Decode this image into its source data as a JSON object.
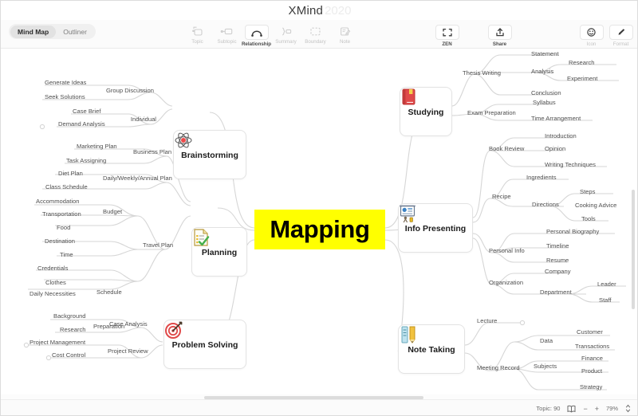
{
  "window": {
    "app_title": "XMind",
    "app_version": "2020"
  },
  "toolbar": {
    "view_tabs": [
      {
        "label": "Mind Map",
        "active": true
      },
      {
        "label": "Outliner",
        "active": false
      }
    ],
    "insert_tools": [
      {
        "label": "Topic",
        "icon": "topic-icon",
        "state": "disabled"
      },
      {
        "label": "Subtopic",
        "icon": "subtopic-icon",
        "state": "disabled"
      },
      {
        "label": "Relationship",
        "icon": "relationship-icon",
        "state": "enabled"
      },
      {
        "label": "Summary",
        "icon": "summary-icon",
        "state": "disabled"
      },
      {
        "label": "Boundary",
        "icon": "boundary-icon",
        "state": "disabled"
      },
      {
        "label": "Note",
        "icon": "note-icon",
        "state": "disabled"
      }
    ],
    "zen_label": "ZEN",
    "zen_icon": "expand-icon",
    "share_label": "Share",
    "share_icon": "share-upload-icon",
    "icon_label": "Icon",
    "icon_icon": "smiley-icon",
    "format_label": "Format",
    "format_icon": "brush-icon"
  },
  "statusbar": {
    "topic_count_label": "Topic: 90",
    "book_icon": "book-icon",
    "zoom_out": "−",
    "zoom_in": "+",
    "zoom_level": "79%",
    "stepper_icon": "chevron-updown-icon"
  },
  "mindmap": {
    "central_topic": "Mapping",
    "central_color": "#ffff00",
    "main_branches": [
      {
        "label": "Brainstorming",
        "icon": "atom-icon",
        "glyph": "⚛"
      },
      {
        "label": "Planning",
        "icon": "checklist-icon",
        "glyph": "📋"
      },
      {
        "label": "Problem Solving",
        "icon": "target-icon",
        "glyph": "🎯"
      },
      {
        "label": "Studying",
        "icon": "book-icon",
        "glyph": "📕"
      },
      {
        "label": "Info Presenting",
        "icon": "presentation-icon",
        "glyph": "📊"
      },
      {
        "label": "Note Taking",
        "icon": "notebook-pencil-icon",
        "glyph": "📝"
      }
    ],
    "brainstorming": {
      "subtopics": [
        "Group Discussion",
        "Individual"
      ],
      "leaves": [
        "Generate Ideas",
        "Seek Solutions",
        "Case Brief",
        "Demand Analysis"
      ]
    },
    "planning": {
      "subtopics": [
        "Business Plan",
        "Daily/Weekly/Annual Plan",
        "Travel Plan"
      ],
      "sub2": [
        "Budget",
        "Schedule",
        "Preparation"
      ],
      "leaves": [
        "Marketing Plan",
        "Task Assigning",
        "Diet Plan",
        "Class Schedule",
        "Accommodation",
        "Transportation",
        "Food",
        "Destination",
        "Time",
        "Credentials",
        "Clothes",
        "Daily Necessities"
      ]
    },
    "problem_solving": {
      "subtopics": [
        "Case Analysis",
        "Project Review"
      ],
      "leaves": [
        "Background",
        "Research",
        "Project Management",
        "Cost Control"
      ]
    },
    "studying": {
      "subtopics": [
        "Thesis Writing",
        "Exam Preparation"
      ],
      "leaves": [
        "Statement",
        "Analysis",
        "Conclusion",
        "Syllabus",
        "Time Arrangement"
      ],
      "deep": [
        "Research",
        "Experiment"
      ]
    },
    "info_presenting": {
      "subtopics": [
        "Book Review",
        "Recipe",
        "Personal Info",
        "Organization"
      ],
      "leaves": [
        "Introduction",
        "Opinion",
        "Writing Techniques",
        "Ingredients",
        "Directions",
        "Personal Biography",
        "Timeline",
        "Resume",
        "Company",
        "Department"
      ],
      "deep": [
        "Steps",
        "Cooking Advice",
        "Tools",
        "Leader",
        "Staff"
      ]
    },
    "note_taking": {
      "subtopics": [
        "Lecture",
        "Meeting Record"
      ],
      "leaves": [
        "Data",
        "Subjects"
      ],
      "deep": [
        "Customer",
        "Transactions",
        "Finance",
        "Product",
        "Strategy"
      ]
    }
  }
}
